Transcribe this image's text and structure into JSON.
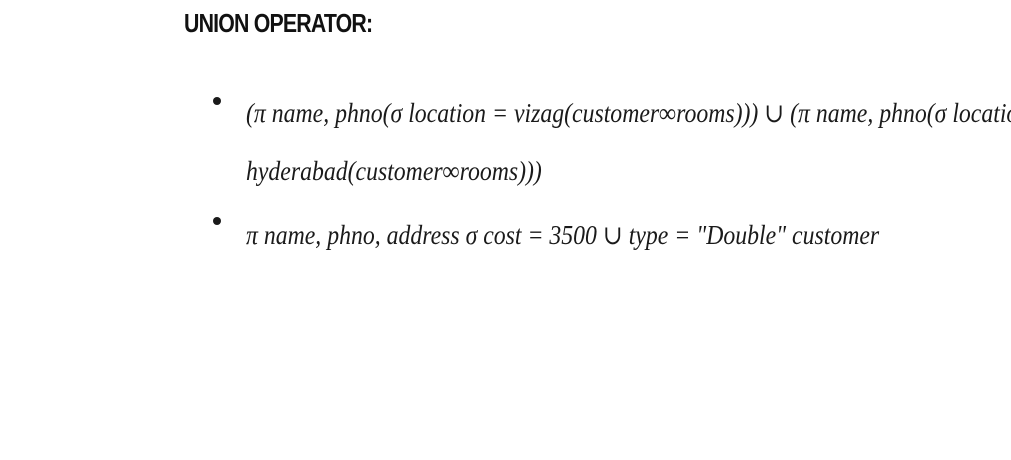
{
  "heading": "UNION OPERATOR:",
  "bullets": [
    {
      "line1": "(π name, phno(σ location = vizag(customer∞rooms))) ∪ (π name, phno(σ location =",
      "line2": "hyderabad(customer∞rooms)))"
    },
    {
      "line1": "π name, phno, address σ cost = 3500 ∪ type = \"Double\" customer"
    }
  ]
}
